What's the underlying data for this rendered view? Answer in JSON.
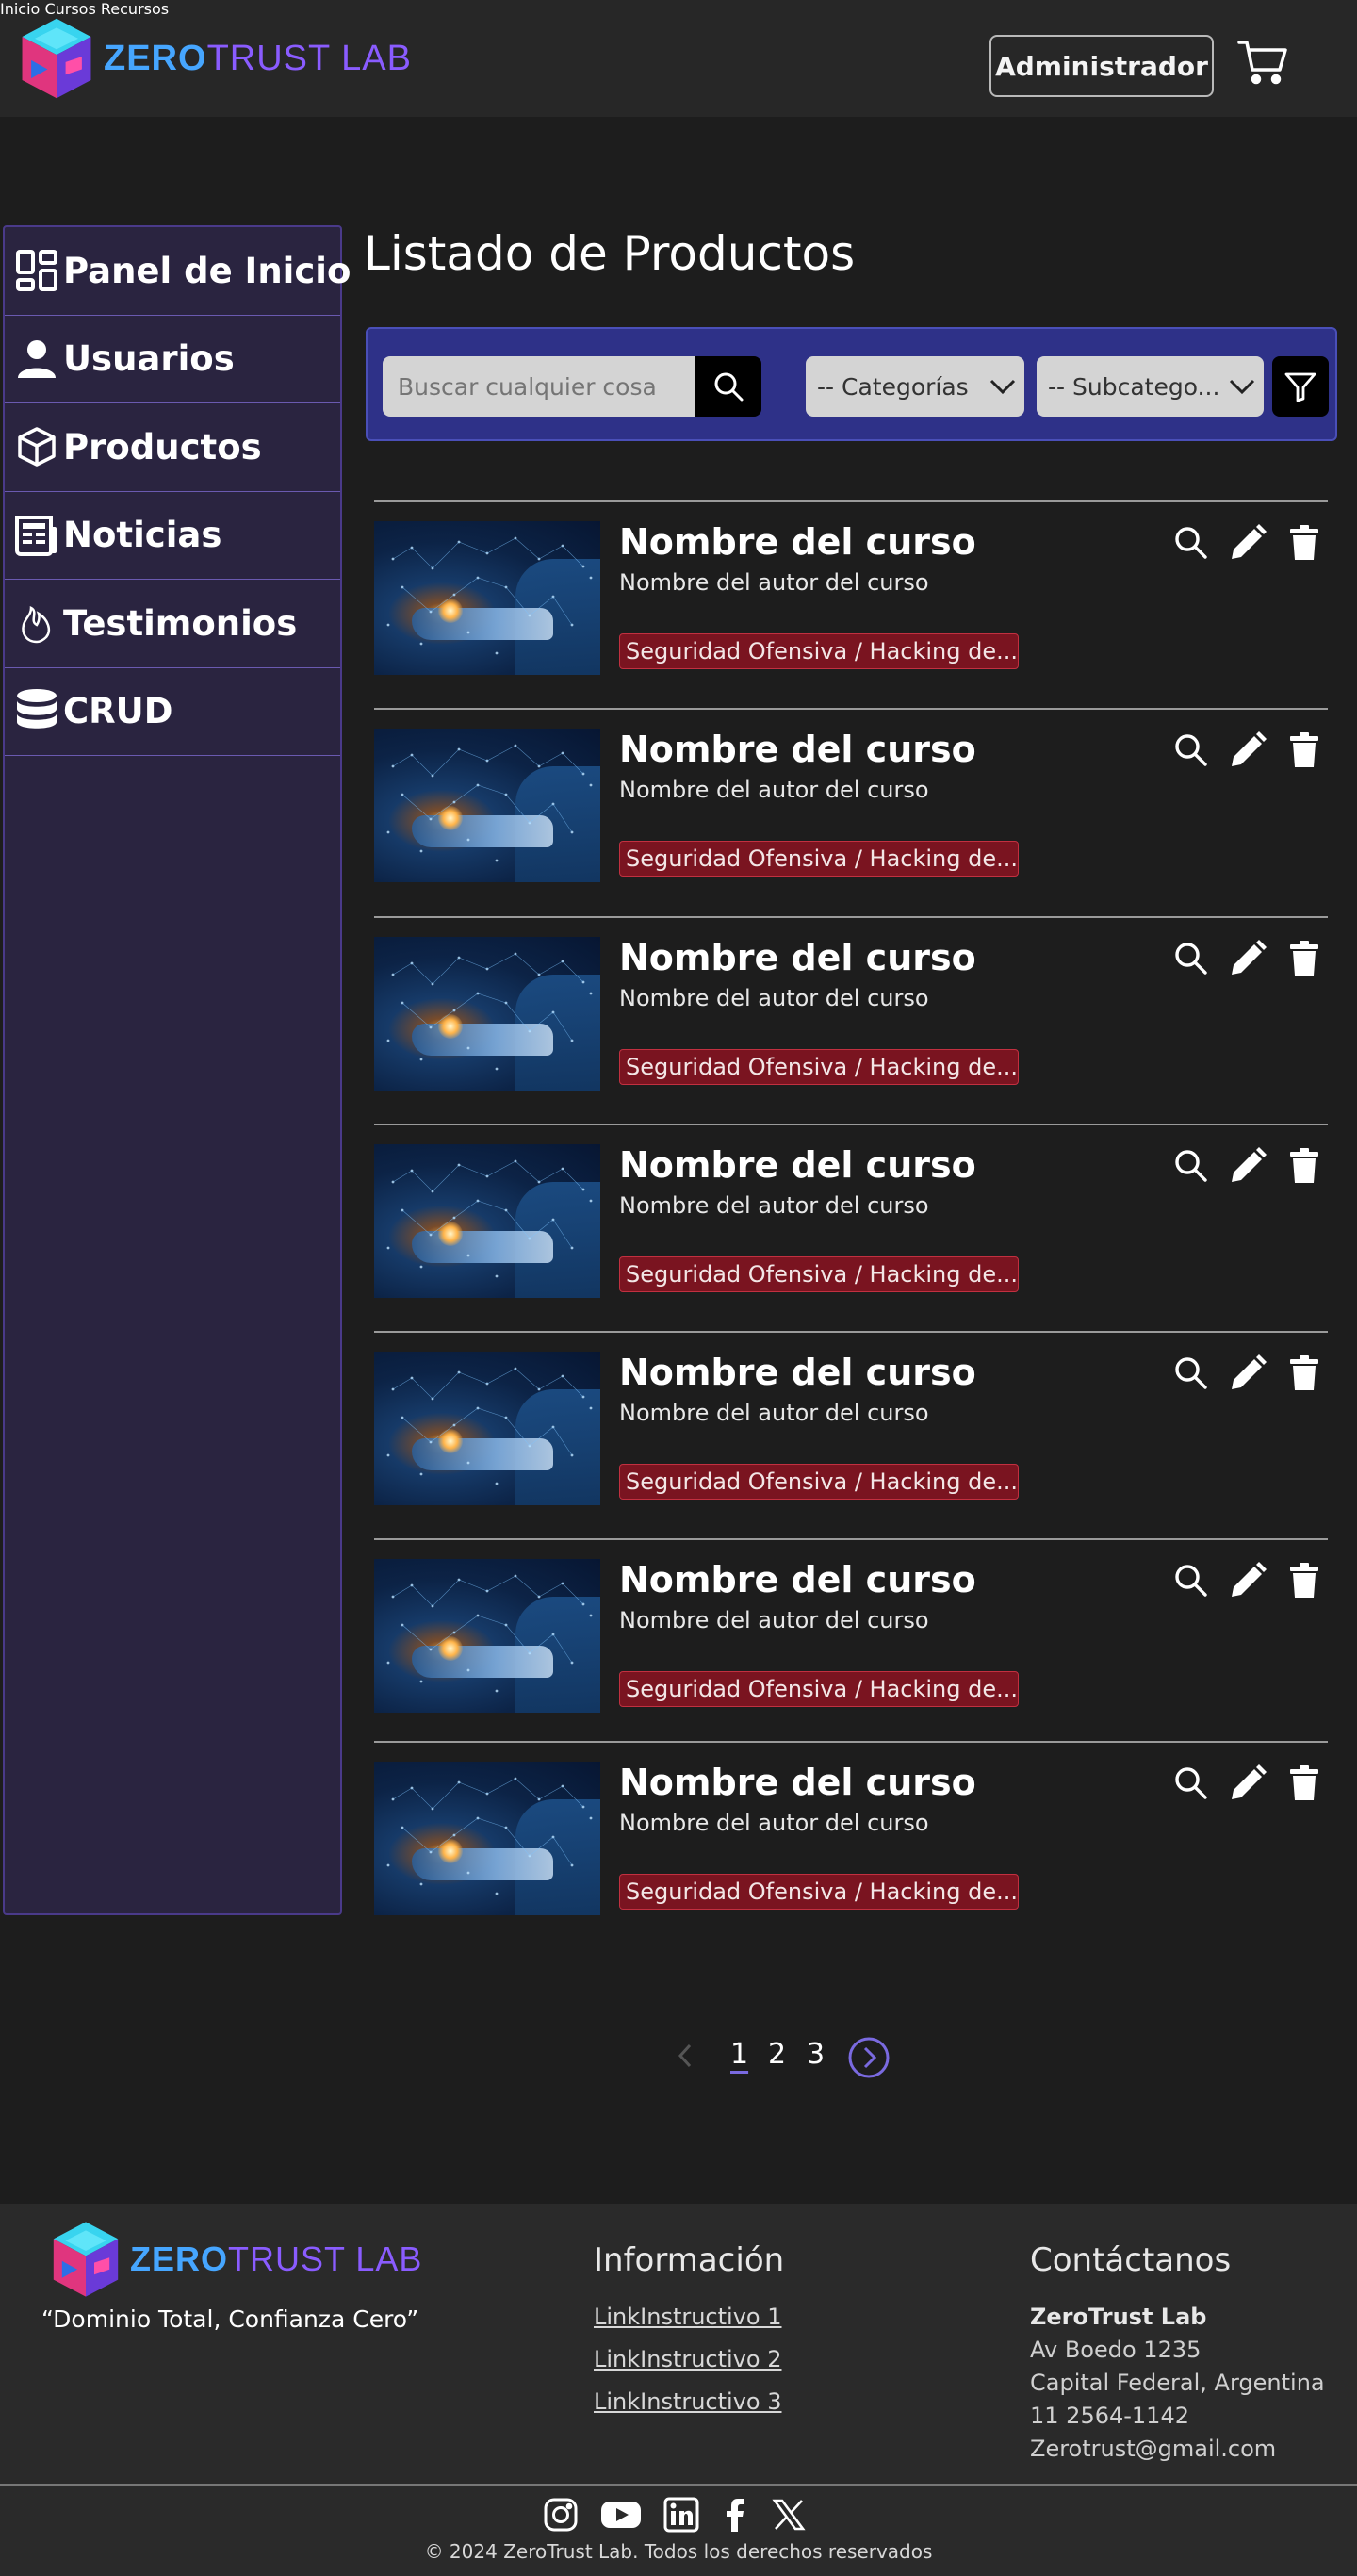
{
  "brand": {
    "logo_part1": "ZERO",
    "logo_part2": "TRUST LAB",
    "colors": {
      "zero": "#46a6ff",
      "trust": "#8a5cff"
    }
  },
  "nav": {
    "items": [
      "Inicio",
      "Cursos",
      "Recursos"
    ],
    "admin_label": "Administrador",
    "cart_icon": "cart-icon"
  },
  "sidebar": {
    "items": [
      {
        "label": "Panel de Inicio",
        "icon": "dashboard-icon"
      },
      {
        "label": "Usuarios",
        "icon": "user-icon"
      },
      {
        "label": "Productos",
        "icon": "box-icon"
      },
      {
        "label": "Noticias",
        "icon": "newspaper-icon"
      },
      {
        "label": "Testimonios",
        "icon": "flame-icon"
      },
      {
        "label": "CRUD",
        "icon": "database-icon"
      }
    ]
  },
  "main": {
    "title": "Listado de Productos",
    "search_placeholder": "Buscar cualquier cosa",
    "category_select": "-- Categorías",
    "subcategory_select": "-- Subcatego...",
    "products": [
      {
        "title": "Nombre del curso",
        "author": "Nombre del autor del curso",
        "tag": "Seguridad Ofensiva / Hacking de..."
      },
      {
        "title": "Nombre del curso",
        "author": "Nombre del autor del curso",
        "tag": "Seguridad Ofensiva / Hacking de..."
      },
      {
        "title": "Nombre del curso",
        "author": "Nombre del autor del curso",
        "tag": "Seguridad Ofensiva / Hacking de..."
      },
      {
        "title": "Nombre del curso",
        "author": "Nombre del autor del curso",
        "tag": "Seguridad Ofensiva / Hacking de..."
      },
      {
        "title": "Nombre del curso",
        "author": "Nombre del autor del curso",
        "tag": "Seguridad Ofensiva / Hacking de..."
      },
      {
        "title": "Nombre del curso",
        "author": "Nombre del autor del curso",
        "tag": "Seguridad Ofensiva / Hacking de..."
      },
      {
        "title": "Nombre del curso",
        "author": "Nombre del autor del curso",
        "tag": "Seguridad Ofensiva / Hacking de..."
      }
    ],
    "pagination": {
      "pages": [
        "1",
        "2",
        "3"
      ],
      "current": "1"
    }
  },
  "footer": {
    "slogan": "“Dominio Total, Confianza Cero”",
    "info_title": "Información",
    "links": [
      "LinkInstructivo 1",
      "LinkInstructivo 2",
      "LinkInstructivo 3"
    ],
    "contact_title": "Contáctanos",
    "contact": {
      "company": "ZeroTrust Lab",
      "address": "Av Boedo 1235",
      "city": "Capital Federal, Argentina",
      "phone": "11 2564-1142",
      "email": "Zerotrust@gmail.com"
    },
    "socials": [
      "instagram-icon",
      "youtube-icon",
      "linkedin-icon",
      "facebook-icon",
      "x-icon"
    ],
    "copyright": "© 2024 ZeroTrust Lab. Todos los derechos reservados"
  }
}
